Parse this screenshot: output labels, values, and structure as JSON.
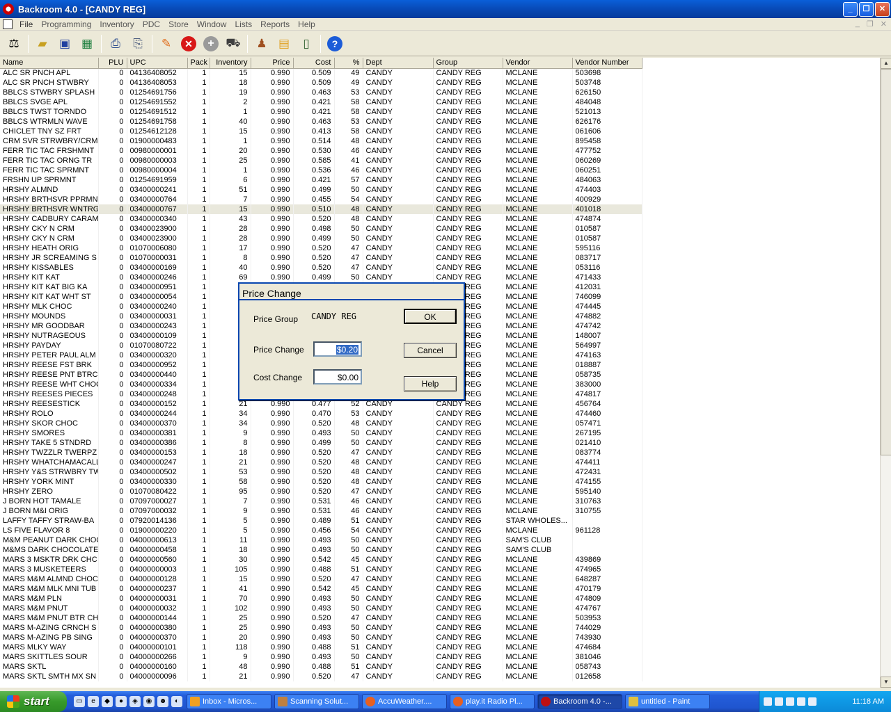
{
  "window": {
    "title": "Backroom 4.0 - [CANDY REG]"
  },
  "menu": [
    "File",
    "Programming",
    "Inventory",
    "PDC",
    "Store",
    "Window",
    "Lists",
    "Reports",
    "Help"
  ],
  "toolbar_icons": [
    "scale-icon",
    "folder-icon",
    "save-icon",
    "grid-icon",
    "print-icon",
    "print-preview-icon",
    "pencil-icon",
    "delete-icon",
    "add-icon",
    "truck-icon",
    "person-icon",
    "open-box-icon",
    "handheld-icon",
    "help-icon"
  ],
  "columns": [
    "Name",
    "PLU",
    "UPC",
    "Pack",
    "Inventory",
    "Price",
    "Cost",
    "%",
    "Dept",
    "Group",
    "Vendor",
    "Vendor Number"
  ],
  "rows": [
    [
      "ALC SR PNCH APL",
      "0",
      "04136408052",
      "1",
      "15",
      "0.990",
      "0.509",
      "49",
      "CANDY",
      "CANDY REG",
      "MCLANE",
      "503698"
    ],
    [
      "ALC SR PNCH STWBRY",
      "0",
      "04136408053",
      "1",
      "18",
      "0.990",
      "0.509",
      "49",
      "CANDY",
      "CANDY REG",
      "MCLANE",
      "503748"
    ],
    [
      "BBLCS STWBRY SPLASH",
      "0",
      "01254691756",
      "1",
      "19",
      "0.990",
      "0.463",
      "53",
      "CANDY",
      "CANDY REG",
      "MCLANE",
      "626150"
    ],
    [
      "BBLCS SVGE APL",
      "0",
      "01254691552",
      "1",
      "2",
      "0.990",
      "0.421",
      "58",
      "CANDY",
      "CANDY REG",
      "MCLANE",
      "484048"
    ],
    [
      "BBLCS TWST TORNDO",
      "0",
      "01254691512",
      "1",
      "1",
      "0.990",
      "0.421",
      "58",
      "CANDY",
      "CANDY REG",
      "MCLANE",
      "521013"
    ],
    [
      "BBLCS WTRMLN WAVE",
      "0",
      "01254691758",
      "1",
      "40",
      "0.990",
      "0.463",
      "53",
      "CANDY",
      "CANDY REG",
      "MCLANE",
      "626176"
    ],
    [
      "CHICLET TNY SZ FRT",
      "0",
      "01254612128",
      "1",
      "15",
      "0.990",
      "0.413",
      "58",
      "CANDY",
      "CANDY REG",
      "MCLANE",
      "061606"
    ],
    [
      "CRM SVR STRWBRY/CRM",
      "0",
      "01900000483",
      "1",
      "1",
      "0.990",
      "0.514",
      "48",
      "CANDY",
      "CANDY REG",
      "MCLANE",
      "895458"
    ],
    [
      "FERR TIC TAC FRSHMNT",
      "0",
      "00980000001",
      "1",
      "20",
      "0.990",
      "0.530",
      "46",
      "CANDY",
      "CANDY REG",
      "MCLANE",
      "477752"
    ],
    [
      "FERR TIC TAC ORNG TR",
      "0",
      "00980000003",
      "1",
      "25",
      "0.990",
      "0.585",
      "41",
      "CANDY",
      "CANDY REG",
      "MCLANE",
      "060269"
    ],
    [
      "FERR TIC TAC SPRMNT",
      "0",
      "00980000004",
      "1",
      "1",
      "0.990",
      "0.536",
      "46",
      "CANDY",
      "CANDY REG",
      "MCLANE",
      "060251"
    ],
    [
      "FRSHN UP SPRMNT",
      "0",
      "01254691959",
      "1",
      "6",
      "0.990",
      "0.421",
      "57",
      "CANDY",
      "CANDY REG",
      "MCLANE",
      "484063"
    ],
    [
      "HRSHY ALMND",
      "0",
      "03400000241",
      "1",
      "51",
      "0.990",
      "0.499",
      "50",
      "CANDY",
      "CANDY REG",
      "MCLANE",
      "474403"
    ],
    [
      "HRSHY BRTHSVR PPRMNT",
      "0",
      "03400000764",
      "1",
      "7",
      "0.990",
      "0.455",
      "54",
      "CANDY",
      "CANDY REG",
      "MCLANE",
      "400929"
    ],
    [
      "HRSHY BRTHSVR WNTRGR",
      "0",
      "03400000767",
      "1",
      "15",
      "0.990",
      "0.510",
      "48",
      "CANDY",
      "CANDY REG",
      "MCLANE",
      "401018"
    ],
    [
      "HRSHY CADBURY CARAME",
      "0",
      "03400000340",
      "1",
      "43",
      "0.990",
      "0.520",
      "48",
      "CANDY",
      "CANDY REG",
      "MCLANE",
      "474874"
    ],
    [
      "HRSHY CKY N CRM",
      "0",
      "03400023900",
      "1",
      "28",
      "0.990",
      "0.498",
      "50",
      "CANDY",
      "CANDY REG",
      "MCLANE",
      "010587"
    ],
    [
      "HRSHY CKY N CRM",
      "0",
      "03400023900",
      "1",
      "28",
      "0.990",
      "0.499",
      "50",
      "CANDY",
      "CANDY REG",
      "MCLANE",
      "010587"
    ],
    [
      "HRSHY HEATH ORIG",
      "0",
      "01070006080",
      "1",
      "17",
      "0.990",
      "0.520",
      "47",
      "CANDY",
      "CANDY REG",
      "MCLANE",
      "595116"
    ],
    [
      "HRSHY JR SCREAMING S",
      "0",
      "01070000031",
      "1",
      "8",
      "0.990",
      "0.520",
      "47",
      "CANDY",
      "CANDY REG",
      "MCLANE",
      "083717"
    ],
    [
      "HRSHY KISSABLES",
      "0",
      "03400000169",
      "1",
      "40",
      "0.990",
      "0.520",
      "47",
      "CANDY",
      "CANDY REG",
      "MCLANE",
      "053116"
    ],
    [
      "HRSHY KIT KAT",
      "0",
      "03400000246",
      "1",
      "69",
      "0.990",
      "0.499",
      "50",
      "CANDY",
      "CANDY REG",
      "MCLANE",
      "471433"
    ],
    [
      "HRSHY KIT KAT BIG KA",
      "0",
      "03400000951",
      "1",
      "",
      "",
      "",
      "",
      "",
      "CANDY REG",
      "MCLANE",
      "412031"
    ],
    [
      "HRSHY KIT KAT WHT ST",
      "0",
      "03400000054",
      "1",
      "",
      "",
      "",
      "",
      "",
      "CANDY REG",
      "MCLANE",
      "746099"
    ],
    [
      "HRSHY MLK CHOC",
      "0",
      "03400000240",
      "1",
      "",
      "",
      "",
      "",
      "",
      "CANDY REG",
      "MCLANE",
      "474445"
    ],
    [
      "HRSHY MOUNDS",
      "0",
      "03400000031",
      "1",
      "",
      "",
      "",
      "",
      "",
      "CANDY REG",
      "MCLANE",
      "474882"
    ],
    [
      "HRSHY MR GOODBAR",
      "0",
      "03400000243",
      "1",
      "",
      "",
      "",
      "",
      "",
      "CANDY REG",
      "MCLANE",
      "474742"
    ],
    [
      "HRSHY NUTRAGEOUS",
      "0",
      "03400000109",
      "1",
      "",
      "",
      "",
      "",
      "",
      "CANDY REG",
      "MCLANE",
      "148007"
    ],
    [
      "HRSHY PAYDAY",
      "0",
      "01070080722",
      "1",
      "",
      "",
      "",
      "",
      "",
      "CANDY REG",
      "MCLANE",
      "564997"
    ],
    [
      "HRSHY PETER PAUL ALM",
      "0",
      "03400000320",
      "1",
      "",
      "",
      "",
      "",
      "",
      "CANDY REG",
      "MCLANE",
      "474163"
    ],
    [
      "HRSHY REESE FST BRK",
      "0",
      "03400000952",
      "1",
      "",
      "",
      "",
      "",
      "",
      "CANDY REG",
      "MCLANE",
      "018887"
    ],
    [
      "HRSHY REESE PNT BTRC",
      "0",
      "03400000440",
      "1",
      "",
      "",
      "",
      "",
      "",
      "CANDY REG",
      "MCLANE",
      "058735"
    ],
    [
      "HRSHY REESE WHT CHOC",
      "0",
      "03400000334",
      "1",
      "",
      "",
      "",
      "",
      "",
      "CANDY REG",
      "MCLANE",
      "383000"
    ],
    [
      "HRSHY REESES PIECES",
      "0",
      "03400000248",
      "1",
      "",
      "",
      "",
      "",
      "",
      "CANDY REG",
      "MCLANE",
      "474817"
    ],
    [
      "HRSHY REESESTICK",
      "0",
      "03400000152",
      "1",
      "21",
      "0.990",
      "0.477",
      "52",
      "CANDY",
      "CANDY REG",
      "MCLANE",
      "456764"
    ],
    [
      "HRSHY ROLO",
      "0",
      "03400000244",
      "1",
      "34",
      "0.990",
      "0.470",
      "53",
      "CANDY",
      "CANDY REG",
      "MCLANE",
      "474460"
    ],
    [
      "HRSHY SKOR CHOC",
      "0",
      "03400000370",
      "1",
      "34",
      "0.990",
      "0.520",
      "48",
      "CANDY",
      "CANDY REG",
      "MCLANE",
      "057471"
    ],
    [
      "HRSHY SMORES",
      "0",
      "03400000381",
      "1",
      "9",
      "0.990",
      "0.493",
      "50",
      "CANDY",
      "CANDY REG",
      "MCLANE",
      "267195"
    ],
    [
      "HRSHY TAKE 5 STNDRD",
      "0",
      "03400000386",
      "1",
      "8",
      "0.990",
      "0.499",
      "50",
      "CANDY",
      "CANDY REG",
      "MCLANE",
      "021410"
    ],
    [
      "HRSHY TWZZLR TWERPZ",
      "0",
      "03400000153",
      "1",
      "18",
      "0.990",
      "0.520",
      "47",
      "CANDY",
      "CANDY REG",
      "MCLANE",
      "083774"
    ],
    [
      "HRSHY WHATCHAMACALLI",
      "0",
      "03400000247",
      "1",
      "21",
      "0.990",
      "0.520",
      "48",
      "CANDY",
      "CANDY REG",
      "MCLANE",
      "474411"
    ],
    [
      "HRSHY Y&S STRWBRY TW",
      "0",
      "03400000502",
      "1",
      "53",
      "0.990",
      "0.520",
      "48",
      "CANDY",
      "CANDY REG",
      "MCLANE",
      "472431"
    ],
    [
      "HRSHY YORK MINT",
      "0",
      "03400000330",
      "1",
      "58",
      "0.990",
      "0.520",
      "48",
      "CANDY",
      "CANDY REG",
      "MCLANE",
      "474155"
    ],
    [
      "HRSHY ZERO",
      "0",
      "01070080422",
      "1",
      "95",
      "0.990",
      "0.520",
      "47",
      "CANDY",
      "CANDY REG",
      "MCLANE",
      "595140"
    ],
    [
      "J BORN HOT TAMALE",
      "0",
      "07097000027",
      "1",
      "7",
      "0.990",
      "0.531",
      "46",
      "CANDY",
      "CANDY REG",
      "MCLANE",
      "310763"
    ],
    [
      "J BORN M&I ORIG",
      "0",
      "07097000032",
      "1",
      "9",
      "0.990",
      "0.531",
      "46",
      "CANDY",
      "CANDY REG",
      "MCLANE",
      "310755"
    ],
    [
      "LAFFY TAFFY STRAW-BA",
      "0",
      "07920014136",
      "1",
      "5",
      "0.990",
      "0.489",
      "51",
      "CANDY",
      "CANDY REG",
      "STAR WHOLES...",
      ""
    ],
    [
      "LS FIVE FLAVOR     8",
      "0",
      "01900000220",
      "1",
      "5",
      "0.990",
      "0.456",
      "54",
      "CANDY",
      "CANDY REG",
      "MCLANE",
      "961128"
    ],
    [
      "M&M PEANUT DARK CHOC",
      "0",
      "04000000613",
      "1",
      "11",
      "0.990",
      "0.493",
      "50",
      "CANDY",
      "CANDY REG",
      "SAM'S CLUB",
      ""
    ],
    [
      "M&MS DARK CHOCOLATE",
      "0",
      "04000000458",
      "1",
      "18",
      "0.990",
      "0.493",
      "50",
      "CANDY",
      "CANDY REG",
      "SAM'S CLUB",
      ""
    ],
    [
      "MARS 3 MSKTR DRK CHC",
      "0",
      "04000000560",
      "1",
      "30",
      "0.990",
      "0.542",
      "45",
      "CANDY",
      "CANDY REG",
      "MCLANE",
      "439869"
    ],
    [
      "MARS 3 MUSKETEERS",
      "0",
      "04000000003",
      "1",
      "105",
      "0.990",
      "0.488",
      "51",
      "CANDY",
      "CANDY REG",
      "MCLANE",
      "474965"
    ],
    [
      "MARS M&M ALMND CHOC",
      "0",
      "04000000128",
      "1",
      "15",
      "0.990",
      "0.520",
      "47",
      "CANDY",
      "CANDY REG",
      "MCLANE",
      "648287"
    ],
    [
      "MARS M&M MLK MNI TUB",
      "0",
      "04000000237",
      "1",
      "41",
      "0.990",
      "0.542",
      "45",
      "CANDY",
      "CANDY REG",
      "MCLANE",
      "470179"
    ],
    [
      "MARS M&M PLN",
      "0",
      "04000000031",
      "1",
      "70",
      "0.990",
      "0.493",
      "50",
      "CANDY",
      "CANDY REG",
      "MCLANE",
      "474809"
    ],
    [
      "MARS M&M PNUT",
      "0",
      "04000000032",
      "1",
      "102",
      "0.990",
      "0.493",
      "50",
      "CANDY",
      "CANDY REG",
      "MCLANE",
      "474767"
    ],
    [
      "MARS M&M PNUT BTR CH",
      "0",
      "04000000144",
      "1",
      "25",
      "0.990",
      "0.520",
      "47",
      "CANDY",
      "CANDY REG",
      "MCLANE",
      "503953"
    ],
    [
      "MARS M-AZING CRNCH S",
      "0",
      "04000000380",
      "1",
      "25",
      "0.990",
      "0.493",
      "50",
      "CANDY",
      "CANDY REG",
      "MCLANE",
      "744029"
    ],
    [
      "MARS M-AZING PB SING",
      "0",
      "04000000370",
      "1",
      "20",
      "0.990",
      "0.493",
      "50",
      "CANDY",
      "CANDY REG",
      "MCLANE",
      "743930"
    ],
    [
      "MARS MLKY WAY",
      "0",
      "04000000101",
      "1",
      "118",
      "0.990",
      "0.488",
      "51",
      "CANDY",
      "CANDY REG",
      "MCLANE",
      "474684"
    ],
    [
      "MARS SKITTLES SOUR",
      "0",
      "04000000266",
      "1",
      "9",
      "0.990",
      "0.493",
      "50",
      "CANDY",
      "CANDY REG",
      "MCLANE",
      "381046"
    ],
    [
      "MARS SKTL",
      "0",
      "04000000160",
      "1",
      "48",
      "0.990",
      "0.488",
      "51",
      "CANDY",
      "CANDY REG",
      "MCLANE",
      "058743"
    ],
    [
      "MARS SKTL SMTH MX SN",
      "0",
      "04000000096",
      "1",
      "21",
      "0.990",
      "0.520",
      "47",
      "CANDY",
      "CANDY REG",
      "MCLANE",
      "012658"
    ]
  ],
  "selected_row": 14,
  "dialog": {
    "title": "Price Change",
    "price_group_label": "Price Group",
    "price_group_value": "CANDY REG",
    "price_change_label": "Price Change",
    "price_change_value": "$0.20",
    "cost_change_label": "Cost Change",
    "cost_change_value": "$0.00",
    "ok": "OK",
    "cancel": "Cancel",
    "help": "Help"
  },
  "taskbar": {
    "start": "start",
    "tasks": [
      "Inbox - Micros...",
      "Scanning Solut...",
      "AccuWeather....",
      "play.it Radio Pl...",
      "Backroom 4.0 -...",
      "untitled - Paint"
    ],
    "active_task": 4,
    "clock": "11:18 AM"
  }
}
